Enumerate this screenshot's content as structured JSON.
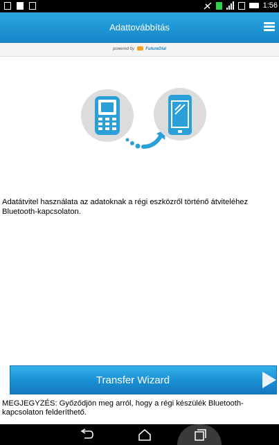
{
  "status_bar": {
    "time": "1:56",
    "icons": [
      "sd-card-icon",
      "document-icon",
      "image-icon",
      "mute-icon",
      "data-icon",
      "signal-icon",
      "sim-icon",
      "battery-icon"
    ]
  },
  "app_bar": {
    "title": "Adattovábbítás",
    "menu_icon": "menu-icon"
  },
  "powered_by": {
    "prefix": "powered by",
    "brand": "FutureDial"
  },
  "description": "Adatátvitel használata az adatoknak a régi eszközről történő átviteléhez Bluetooth-kapcsolaton.",
  "transfer_button": {
    "label": "Transfer Wizard",
    "icon": "play-arrow-icon"
  },
  "note": "MEGJEGYZÉS: Győződjön meg arról, hogy a régi készülék Bluetooth-kapcsolaton felderíthető.",
  "nav_bar": {
    "icons": [
      "back-icon",
      "home-icon",
      "recent-apps-icon"
    ]
  },
  "colors": {
    "accent": "#1e8fd6",
    "illustration_blue": "#2b9fd8",
    "circle_bg": "#dcdcdc"
  }
}
